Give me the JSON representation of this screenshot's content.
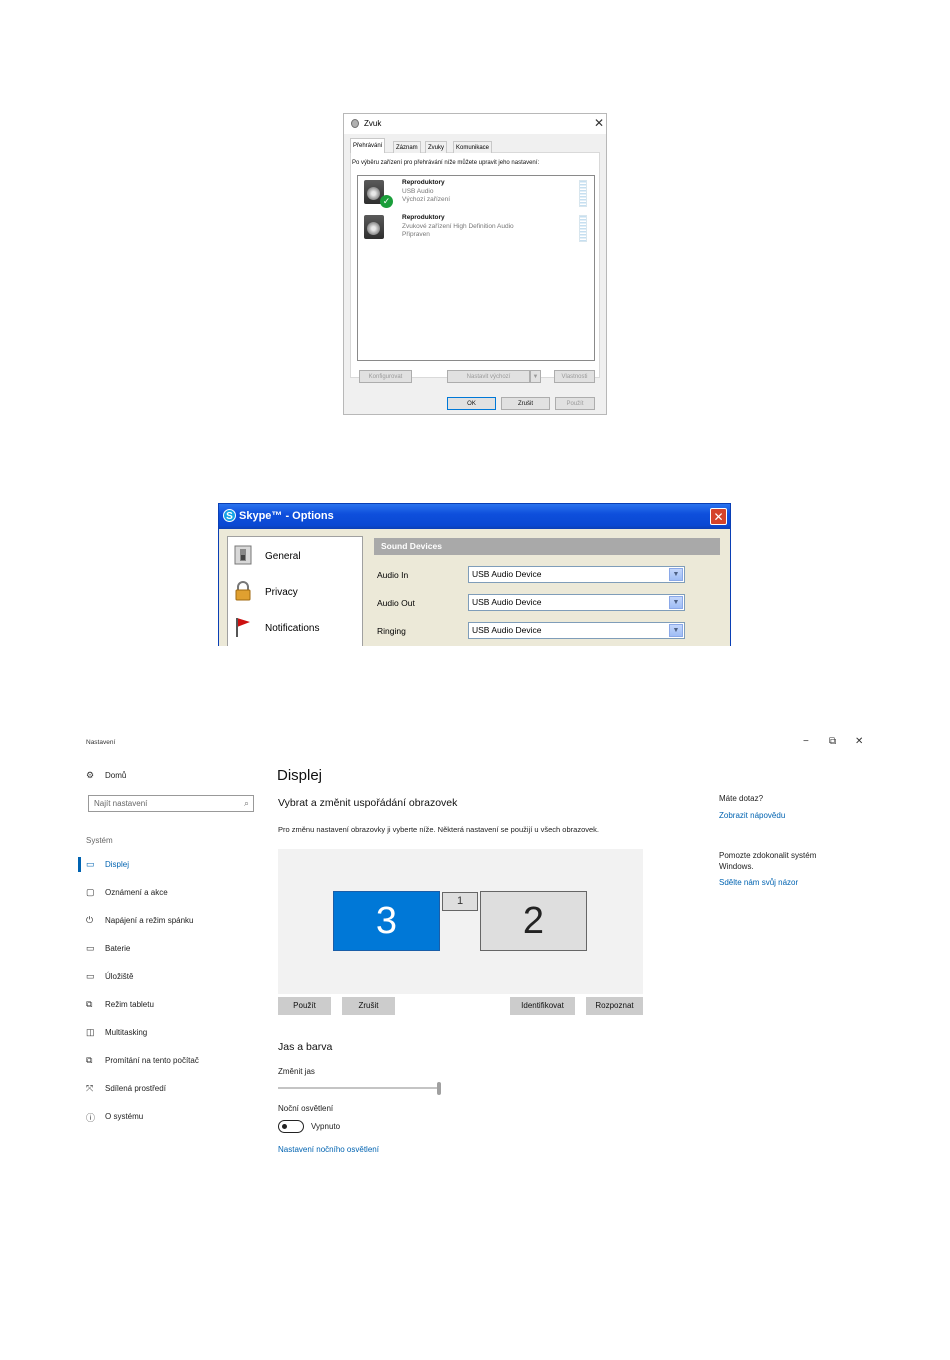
{
  "sound_dialog": {
    "title": "Zvuk",
    "tabs": [
      "Přehrávání",
      "Záznam",
      "Zvuky",
      "Komunikace"
    ],
    "instruction": "Po výběru zařízení pro přehrávání níže můžete upravit jeho nastavení:",
    "devices": [
      {
        "name": "Reproduktory",
        "line1": "USB Audio",
        "line2": "Výchozí zařízení",
        "default": true
      },
      {
        "name": "Reproduktory",
        "line1": "Zvukové zařízení High Definition Audio",
        "line2": "Připraven",
        "default": false
      }
    ],
    "buttons": {
      "configure": "Konfigurovat",
      "set_default": "Nastavit výchozí",
      "dropdown": "▼",
      "properties": "Vlastnosti",
      "ok": "OK",
      "cancel": "Zrušit",
      "apply": "Použít"
    },
    "close": "✕"
  },
  "skype_dialog": {
    "title": "Skype™ - Options",
    "icon_letter": "S",
    "close": "✕",
    "nav": [
      "General",
      "Privacy",
      "Notifications"
    ],
    "section_header": "Sound Devices",
    "rows": [
      {
        "label": "Audio In",
        "value": "USB Audio Device"
      },
      {
        "label": "Audio Out",
        "value": "USB Audio Device"
      },
      {
        "label": "Ringing",
        "value": "USB Audio Device"
      }
    ],
    "dropdown_arrow": "▼"
  },
  "settings": {
    "window_title": "Nastavení",
    "window_controls": {
      "minimize": "−",
      "restore": "⧉",
      "close": "✕"
    },
    "home": "Domů",
    "search_placeholder": "Najít nastavení",
    "section": "Systém",
    "sidebar": [
      {
        "label": "Displej",
        "icon": "▭",
        "active": true
      },
      {
        "label": "Oznámení a akce",
        "icon": "▢",
        "active": false
      },
      {
        "label": "Napájení a režim spánku",
        "icon": "⏻",
        "active": false
      },
      {
        "label": "Baterie",
        "icon": "▭",
        "active": false
      },
      {
        "label": "Úložiště",
        "icon": "▭",
        "active": false
      },
      {
        "label": "Režim tabletu",
        "icon": "⧉",
        "active": false
      },
      {
        "label": "Multitasking",
        "icon": "◫",
        "active": false
      },
      {
        "label": "Promítání na tento počítač",
        "icon": "⧉",
        "active": false
      },
      {
        "label": "Sdílená prostředí",
        "icon": "⤧",
        "active": false
      },
      {
        "label": "O systému",
        "icon": "ⓘ",
        "active": false
      }
    ],
    "page_title": "Displej",
    "subtitle": "Vybrat a změnit uspořádání obrazovek",
    "description": "Pro změnu nastavení obrazovky ji vyberte níže. Některá nastavení se použijí u všech obrazovek.",
    "monitors": [
      "3",
      "1",
      "2"
    ],
    "buttons": {
      "apply": "Použít",
      "cancel": "Zrušit",
      "identify": "Identifikovat",
      "detect": "Rozpoznat"
    },
    "brightness_section": "Jas a barva",
    "brightness_label": "Změnit jas",
    "brightness_value": 1.0,
    "night_light_label": "Noční osvětlení",
    "night_light_state": "Vypnuto",
    "night_light_link": "Nastavení nočního osvětlení",
    "help": {
      "question": "Máte dotaz?",
      "help_link": "Zobrazit nápovědu",
      "improve": "Pomozte zdokonalit systém Windows.",
      "feedback_link": "Sdělte nám svůj názor"
    }
  }
}
